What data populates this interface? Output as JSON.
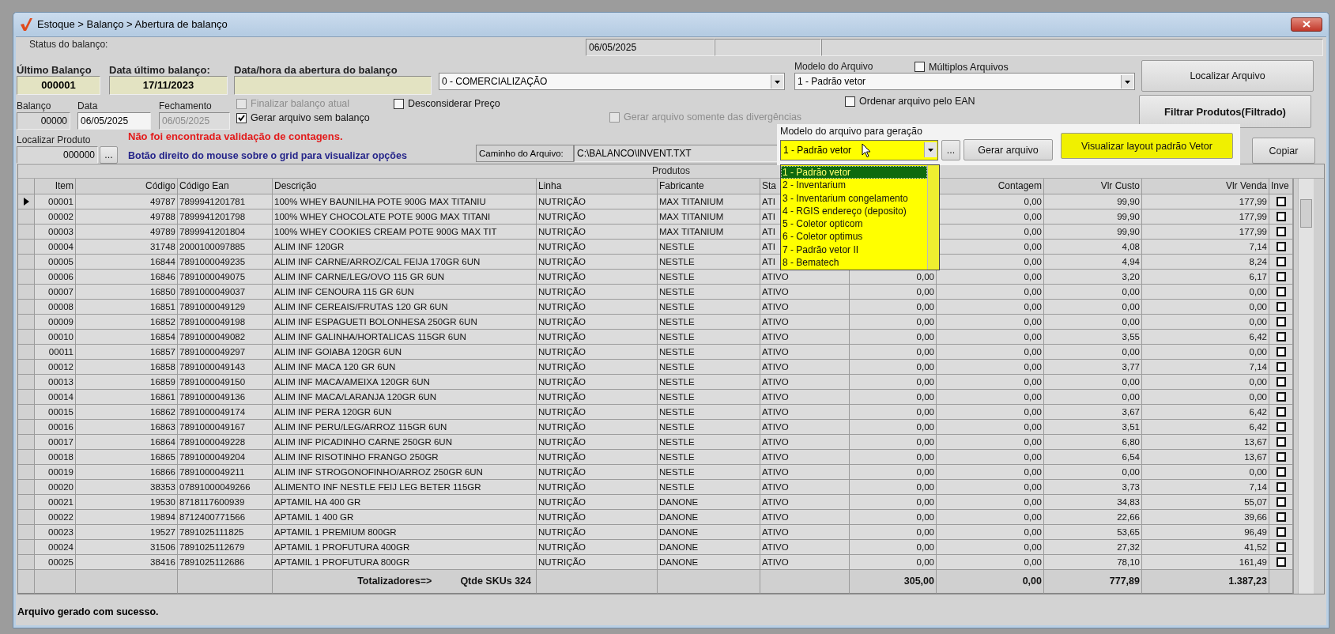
{
  "window": {
    "title": "Estoque > Balanço > Abertura de balanço"
  },
  "status": {
    "label": "Status do balanço:",
    "date": "06/05/2025"
  },
  "ultimo_balanco": {
    "label": "Último Balanço",
    "value": "000001"
  },
  "data_ultimo": {
    "label": "Data último balanço:",
    "value": "17/11/2023"
  },
  "abertura": {
    "label": "Data/hora da abertura do balanço"
  },
  "tipo": {
    "value": "0 - COMERCIALIZAÇÃO"
  },
  "modelo": {
    "label": "Modelo do Arquivo",
    "value": "1 - Padrão vetor"
  },
  "options": {
    "multiplos": {
      "label": "Múltiplos Arquivos",
      "checked": false,
      "disabled": false
    },
    "finalizar": {
      "label": "Finalizar balanço atual",
      "checked": false,
      "disabled": true
    },
    "gerar_sem": {
      "label": "Gerar arquivo sem balanço",
      "checked": true,
      "disabled": false
    },
    "desconsiderar": {
      "label": "Desconsiderar Preço",
      "checked": false,
      "disabled": false
    },
    "divergencias": {
      "label": "Gerar arquivo somente das divergências",
      "checked": false,
      "disabled": true
    },
    "ordenar": {
      "label": "Ordenar arquivo pelo EAN",
      "checked": false,
      "disabled": false
    }
  },
  "balanco": {
    "label": "Balanço",
    "value": "00000"
  },
  "data": {
    "label": "Data",
    "value": "06/05/2025"
  },
  "fechamento": {
    "label": "Fechamento",
    "value": "06/05/2025",
    "disabled": true
  },
  "localizar_produto": {
    "label": "Localizar Produto",
    "value": "000000",
    "button": "..."
  },
  "messages": {
    "error": "Não foi encontrada validação de contagens.",
    "hint": "Botão direito do mouse sobre o grid para visualizar opções"
  },
  "caminho": {
    "label": "Caminho do Arquivo:",
    "value": "C:\\BALANCO\\INVENT.TXT"
  },
  "buttons": {
    "localizar": "Localizar Arquivo",
    "filtrar": "Filtrar Produtos(Filtrado)",
    "copiar": "Copiar"
  },
  "popup": {
    "label": "Modelo do arquivo para geração",
    "value": "1 - Padrão vetor",
    "browse": "...",
    "generate": "Gerar arquivo",
    "layout": "Visualizar layout padrão Vetor",
    "options": [
      {
        "label": "1 - Padrão vetor",
        "selected": true
      },
      {
        "label": "2 - Inventarium",
        "selected": false
      },
      {
        "label": "3 - Inventarium congelamento",
        "selected": false
      },
      {
        "label": "4 - RGIS endereço (deposito)",
        "selected": false
      },
      {
        "label": "5 - Coletor opticom",
        "selected": false
      },
      {
        "label": "6 - Coletor optimus",
        "selected": false
      },
      {
        "label": "7 - Padrão vetor II",
        "selected": false
      },
      {
        "label": "8 - Bematech",
        "selected": false
      }
    ]
  },
  "table": {
    "caption": "Produtos",
    "columns": [
      "Item",
      "Código",
      "Código Ean",
      "Descrição",
      "Linha",
      "Fabricante",
      "Sta",
      null,
      "Contagem",
      "Vlr Custo",
      "Vlr Venda",
      "Inve"
    ],
    "rows": [
      {
        "selected": true,
        "checked": false,
        "cells": [
          "00001",
          "49787",
          "7899941201781",
          "100% WHEY BAUNILHA POTE 900G MAX TITANIU",
          "NUTRIÇÃO",
          "MAX TITANIUM",
          "ATI",
          null,
          "0,00",
          "99,90",
          "177,99"
        ]
      },
      {
        "selected": false,
        "checked": false,
        "cells": [
          "00002",
          "49788",
          "7899941201798",
          "100% WHEY CHOCOLATE POTE 900G MAX TITANI",
          "NUTRIÇÃO",
          "MAX TITANIUM",
          "ATI",
          null,
          "0,00",
          "99,90",
          "177,99"
        ]
      },
      {
        "selected": false,
        "checked": false,
        "cells": [
          "00003",
          "49789",
          "7899941201804",
          "100% WHEY COOKIES CREAM POTE 900G MAX TIT",
          "NUTRIÇÃO",
          "MAX TITANIUM",
          "ATI",
          null,
          "0,00",
          "99,90",
          "177,99"
        ]
      },
      {
        "selected": false,
        "checked": false,
        "cells": [
          "00004",
          "31748",
          "2000100097885",
          "ALIM INF 120GR",
          "NUTRIÇÃO",
          "NESTLE",
          "ATI",
          null,
          "0,00",
          "4,08",
          "7,14"
        ]
      },
      {
        "selected": false,
        "checked": false,
        "cells": [
          "00005",
          "16844",
          "7891000049235",
          "ALIM INF CARNE/ARROZ/CAL FEIJA 170GR 6UN",
          "NUTRIÇÃO",
          "NESTLE",
          "ATI",
          null,
          "0,00",
          "4,94",
          "8,24"
        ]
      },
      {
        "selected": false,
        "checked": false,
        "cells": [
          "00006",
          "16846",
          "7891000049075",
          "ALIM INF CARNE/LEG/OVO 115 GR 6UN",
          "NUTRIÇÃO",
          "NESTLE",
          "ATIVO",
          "0,00",
          "0,00",
          "3,20",
          "6,17"
        ]
      },
      {
        "selected": false,
        "checked": false,
        "cells": [
          "00007",
          "16850",
          "7891000049037",
          "ALIM INF CENOURA 115 GR 6UN",
          "NUTRIÇÃO",
          "NESTLE",
          "ATIVO",
          "0,00",
          "0,00",
          "0,00",
          "0,00"
        ]
      },
      {
        "selected": false,
        "checked": false,
        "cells": [
          "00008",
          "16851",
          "7891000049129",
          "ALIM INF CEREAIS/FRUTAS 120 GR 6UN",
          "NUTRIÇÃO",
          "NESTLE",
          "ATIVO",
          "0,00",
          "0,00",
          "0,00",
          "0,00"
        ]
      },
      {
        "selected": false,
        "checked": false,
        "cells": [
          "00009",
          "16852",
          "7891000049198",
          "ALIM INF ESPAGUETI BOLONHESA 250GR 6UN",
          "NUTRIÇÃO",
          "NESTLE",
          "ATIVO",
          "0,00",
          "0,00",
          "0,00",
          "0,00"
        ]
      },
      {
        "selected": false,
        "checked": false,
        "cells": [
          "00010",
          "16854",
          "7891000049082",
          "ALIM INF GALINHA/HORTALICAS 115GR 6UN",
          "NUTRIÇÃO",
          "NESTLE",
          "ATIVO",
          "0,00",
          "0,00",
          "3,55",
          "6,42"
        ]
      },
      {
        "selected": false,
        "checked": false,
        "cells": [
          "00011",
          "16857",
          "7891000049297",
          "ALIM INF GOIABA 120GR 6UN",
          "NUTRIÇÃO",
          "NESTLE",
          "ATIVO",
          "0,00",
          "0,00",
          "0,00",
          "0,00"
        ]
      },
      {
        "selected": false,
        "checked": false,
        "cells": [
          "00012",
          "16858",
          "7891000049143",
          "ALIM INF MACA 120 GR 6UN",
          "NUTRIÇÃO",
          "NESTLE",
          "ATIVO",
          "0,00",
          "0,00",
          "3,77",
          "7,14"
        ]
      },
      {
        "selected": false,
        "checked": false,
        "cells": [
          "00013",
          "16859",
          "7891000049150",
          "ALIM INF MACA/AMEIXA 120GR 6UN",
          "NUTRIÇÃO",
          "NESTLE",
          "ATIVO",
          "0,00",
          "0,00",
          "0,00",
          "0,00"
        ]
      },
      {
        "selected": false,
        "checked": false,
        "cells": [
          "00014",
          "16861",
          "7891000049136",
          "ALIM INF MACA/LARANJA 120GR 6UN",
          "NUTRIÇÃO",
          "NESTLE",
          "ATIVO",
          "0,00",
          "0,00",
          "0,00",
          "0,00"
        ]
      },
      {
        "selected": false,
        "checked": false,
        "cells": [
          "00015",
          "16862",
          "7891000049174",
          "ALIM INF PERA 120GR 6UN",
          "NUTRIÇÃO",
          "NESTLE",
          "ATIVO",
          "0,00",
          "0,00",
          "3,67",
          "6,42"
        ]
      },
      {
        "selected": false,
        "checked": false,
        "cells": [
          "00016",
          "16863",
          "7891000049167",
          "ALIM INF PERU/LEG/ARROZ 115GR 6UN",
          "NUTRIÇÃO",
          "NESTLE",
          "ATIVO",
          "0,00",
          "0,00",
          "3,51",
          "6,42"
        ]
      },
      {
        "selected": false,
        "checked": false,
        "cells": [
          "00017",
          "16864",
          "7891000049228",
          "ALIM INF PICADINHO CARNE 250GR 6UN",
          "NUTRIÇÃO",
          "NESTLE",
          "ATIVO",
          "0,00",
          "0,00",
          "6,80",
          "13,67"
        ]
      },
      {
        "selected": false,
        "checked": false,
        "cells": [
          "00018",
          "16865",
          "7891000049204",
          "ALIM INF RISOTINHO FRANGO 250GR",
          "NUTRIÇÃO",
          "NESTLE",
          "ATIVO",
          "0,00",
          "0,00",
          "6,54",
          "13,67"
        ]
      },
      {
        "selected": false,
        "checked": false,
        "cells": [
          "00019",
          "16866",
          "7891000049211",
          "ALIM INF STROGONOFINHO/ARROZ 250GR 6UN",
          "NUTRIÇÃO",
          "NESTLE",
          "ATIVO",
          "0,00",
          "0,00",
          "0,00",
          "0,00"
        ]
      },
      {
        "selected": false,
        "checked": false,
        "cells": [
          "00020",
          "38353",
          "07891000049266",
          "ALIMENTO INF NESTLE FEIJ LEG BETER 115GR",
          "NUTRIÇÃO",
          "NESTLE",
          "ATIVO",
          "0,00",
          "0,00",
          "3,73",
          "7,14"
        ]
      },
      {
        "selected": false,
        "checked": false,
        "cells": [
          "00021",
          "19530",
          "8718117600939",
          "APTAMIL  HA  400 GR",
          "NUTRIÇÃO",
          "DANONE",
          "ATIVO",
          "0,00",
          "0,00",
          "34,83",
          "55,07"
        ]
      },
      {
        "selected": false,
        "checked": false,
        "cells": [
          "00022",
          "19894",
          "8712400771566",
          "APTAMIL 1 400 GR",
          "NUTRIÇÃO",
          "DANONE",
          "ATIVO",
          "0,00",
          "0,00",
          "22,66",
          "39,66"
        ]
      },
      {
        "selected": false,
        "checked": false,
        "cells": [
          "00023",
          "19527",
          "7891025111825",
          "APTAMIL 1 PREMIUM 800GR",
          "NUTRIÇÃO",
          "DANONE",
          "ATIVO",
          "0,00",
          "0,00",
          "53,65",
          "96,49"
        ]
      },
      {
        "selected": false,
        "checked": false,
        "cells": [
          "00024",
          "31506",
          "7891025112679",
          "APTAMIL 1 PROFUTURA 400GR",
          "NUTRIÇÃO",
          "DANONE",
          "ATIVO",
          "0,00",
          "0,00",
          "27,32",
          "41,52"
        ]
      },
      {
        "selected": false,
        "checked": false,
        "cells": [
          "00025",
          "38416",
          "7891025112686",
          "APTAMIL 1 PROFUTURA 800GR",
          "NUTRIÇÃO",
          "DANONE",
          "ATIVO",
          "0,00",
          "0,00",
          "78,10",
          "161,49"
        ]
      }
    ],
    "totals": {
      "label": "Totalizadores=>",
      "count": "Qtde SKUs 324",
      "values": [
        "305,00",
        "0,00",
        "777,89",
        "1.387,23"
      ]
    }
  },
  "status_message": "Arquivo gerado com sucesso."
}
